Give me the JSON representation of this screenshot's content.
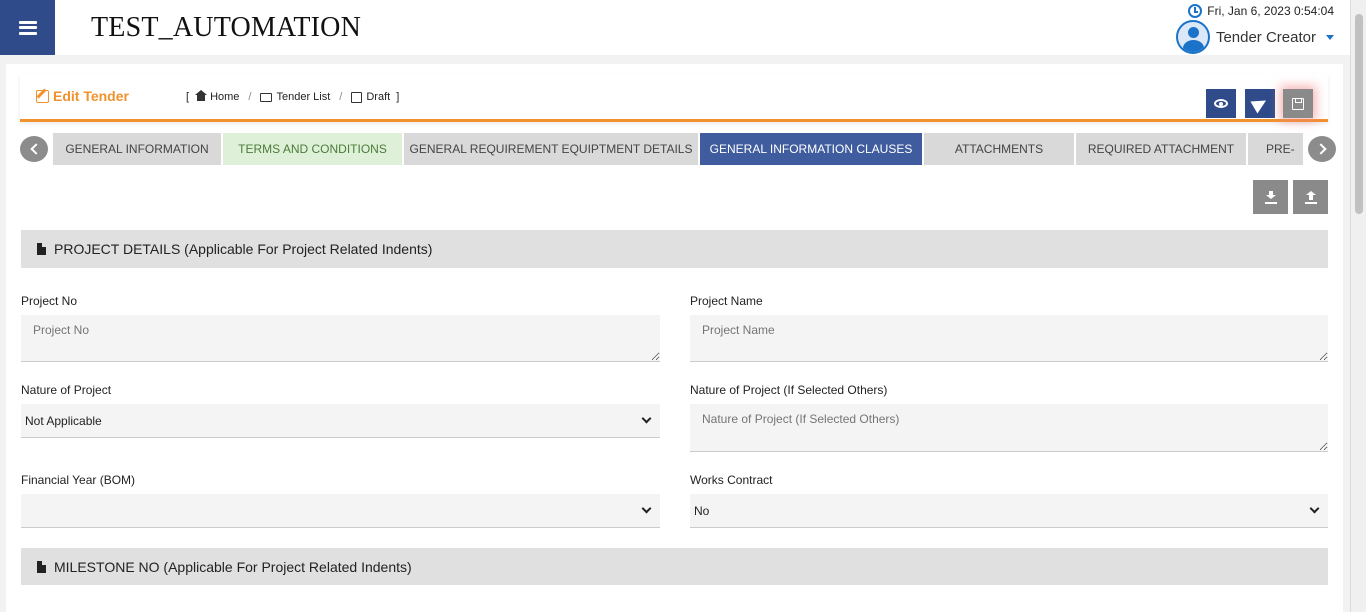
{
  "header": {
    "app_title": "TEST_AUTOMATION",
    "datetime": "Fri, Jan 6, 2023 0:54:04",
    "user_role": "Tender Creator"
  },
  "subheader": {
    "title": "Edit Tender",
    "breadcrumb": [
      {
        "label": "Home",
        "icon": "home-icon"
      },
      {
        "label": "Tender List",
        "icon": "list-icon"
      },
      {
        "label": "Draft",
        "icon": "edit-icon"
      }
    ],
    "breadcrumb_open": "[",
    "breadcrumb_close": "]",
    "actions": [
      "view-icon",
      "send-icon",
      "save-icon"
    ]
  },
  "tabs": [
    {
      "label": "GENERAL INFORMATION",
      "state": "default"
    },
    {
      "label": "TERMS AND CONDITIONS",
      "state": "completed"
    },
    {
      "label": "GENERAL REQUIREMENT EQUIPTMENT DETAILS",
      "state": "default"
    },
    {
      "label": "GENERAL INFORMATION CLAUSES",
      "state": "active"
    },
    {
      "label": "ATTACHMENTS",
      "state": "default"
    },
    {
      "label": "REQUIRED ATTACHMENT",
      "state": "default"
    },
    {
      "label": "PRE-",
      "state": "default"
    }
  ],
  "sections": {
    "project_details": "PROJECT DETAILS (Applicable For Project Related Indents)",
    "milestone": "MILESTONE NO (Applicable For Project Related Indents)"
  },
  "form": {
    "project_no": {
      "label": "Project No",
      "placeholder": "Project No",
      "value": ""
    },
    "project_name": {
      "label": "Project Name",
      "placeholder": "Project Name",
      "value": ""
    },
    "nature_of_project": {
      "label": "Nature of Project",
      "value": "Not Applicable"
    },
    "nature_other": {
      "label": "Nature of Project (If Selected Others)",
      "placeholder": "Nature of Project (If Selected Others)",
      "value": ""
    },
    "financial_year": {
      "label": "Financial Year (BOM)",
      "value": ""
    },
    "works_contract": {
      "label": "Works Contract",
      "value": "No"
    }
  },
  "colors": {
    "primary": "#2f4b8a",
    "accent": "#f0922e",
    "active_tab": "#3f5c9e",
    "completed_tab": "#dff0d8"
  }
}
